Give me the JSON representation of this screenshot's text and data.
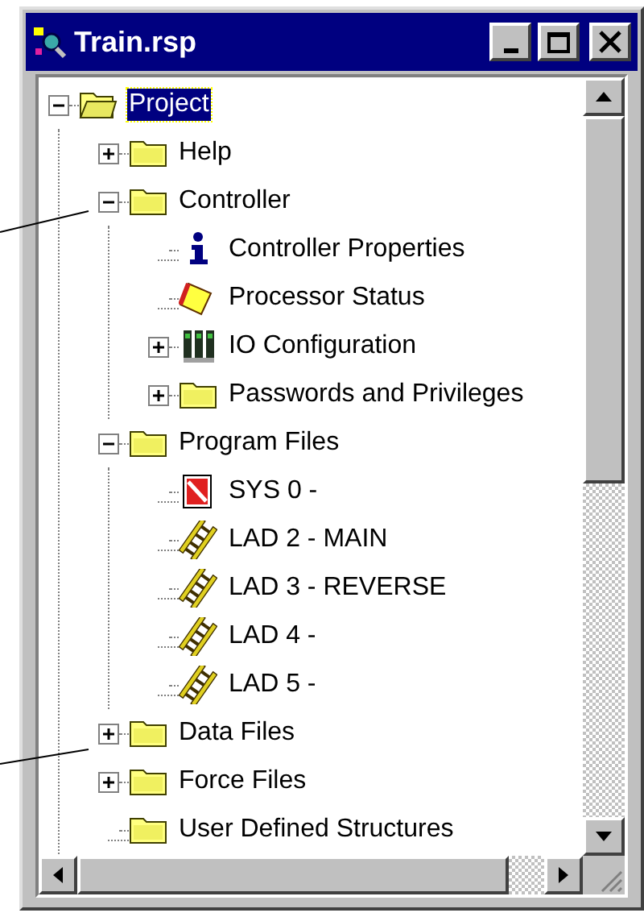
{
  "window": {
    "title": "Train.rsp"
  },
  "tree": [
    {
      "label": "Project",
      "kind": "open-folder",
      "expanded": true,
      "selected": true,
      "children": [
        {
          "label": "Help",
          "kind": "folder",
          "expanded": false,
          "selected": false
        },
        {
          "label": "Controller",
          "kind": "folder",
          "expanded": true,
          "selected": false,
          "children": [
            {
              "label": "Controller Properties",
              "kind": "info",
              "selected": false
            },
            {
              "label": "Processor Status",
              "kind": "status",
              "selected": false
            },
            {
              "label": "IO Configuration",
              "kind": "io",
              "expanded": false,
              "selected": false
            },
            {
              "label": "Passwords and Privileges",
              "kind": "folder",
              "expanded": false,
              "selected": false
            }
          ]
        },
        {
          "label": "Program Files",
          "kind": "folder",
          "expanded": true,
          "selected": false,
          "children": [
            {
              "label": "SYS 0 -",
              "kind": "sys",
              "selected": false
            },
            {
              "label": "LAD 2 - MAIN",
              "kind": "ladder",
              "selected": false
            },
            {
              "label": "LAD 3 - REVERSE",
              "kind": "ladder",
              "selected": false
            },
            {
              "label": "LAD 4 -",
              "kind": "ladder",
              "selected": false
            },
            {
              "label": "LAD 5 -",
              "kind": "ladder",
              "selected": false
            }
          ]
        },
        {
          "label": "Data Files",
          "kind": "folder",
          "expanded": false,
          "selected": false
        },
        {
          "label": "Force Files",
          "kind": "folder",
          "expanded": false,
          "selected": false
        },
        {
          "label": "User Defined Structures",
          "kind": "folder",
          "selected": false
        }
      ]
    }
  ]
}
